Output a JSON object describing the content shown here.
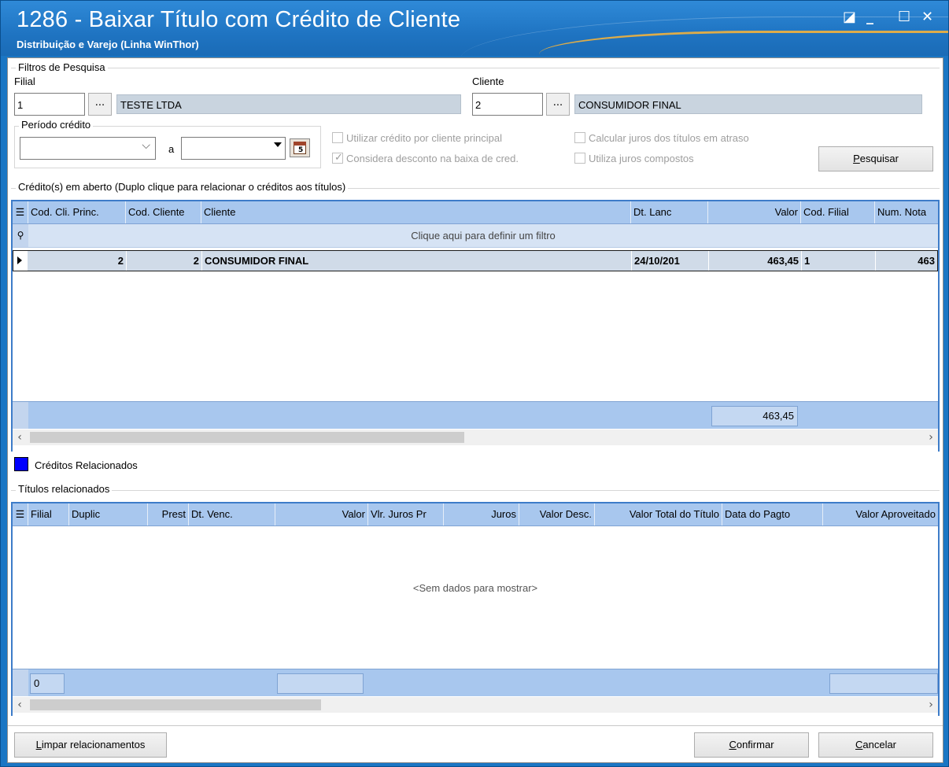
{
  "window": {
    "title": "1286 - Baixar Título com Crédito de Cliente",
    "subtitle": "Distribuição e Varejo (Linha WinThor)",
    "controls": {
      "restore": "◪",
      "minimize": "_",
      "maximize": "☐",
      "close": "✕"
    }
  },
  "filtros": {
    "legend": "Filtros de Pesquisa",
    "filial_label": "Filial",
    "filial_code": "1",
    "filial_name": "TESTE  LTDA",
    "cliente_label": "Cliente",
    "cliente_code": "2",
    "cliente_name": "CONSUMIDOR FINAL",
    "lookup_button": "...",
    "periodo_legend": "Período crédito",
    "periodo_from": "",
    "periodo_sep": "a",
    "periodo_to": "",
    "check_cliente_principal": "Utilizar crédito por cliente principal",
    "check_desconto": "Considera desconto na baixa de cred.",
    "check_juros_atraso": "Calcular juros dos títulos em atraso",
    "check_juros_compostos": "Utiliza juros compostos",
    "pesquisar_prefix": "P",
    "pesquisar_rest": "esquisar"
  },
  "creditos": {
    "legend": "Crédito(s) em aberto  (Duplo clique para relacionar o créditos aos títulos)",
    "columns": [
      "Cod. Cli. Princ.",
      "Cod. Cliente",
      "Cliente",
      "Dt. Lanc",
      "Valor",
      "Cod. Filial",
      "Num. Nota"
    ],
    "filter_hint": "Clique aqui para definir um filtro",
    "rows": [
      [
        "2",
        "2",
        "CONSUMIDOR FINAL",
        "24/10/201",
        "463,45",
        "1",
        "463"
      ]
    ],
    "total_valor": "463,45"
  },
  "legenda": {
    "relacionados": "Créditos Relacionados",
    "color": "#0000ff"
  },
  "titulos": {
    "legend": "Títulos relacionados",
    "columns": [
      "Filial",
      "Duplic",
      "Prest",
      "Dt. Venc.",
      "Valor",
      "Vlr. Juros Pr",
      "Juros",
      "Valor Desc.",
      "Valor Total do Título",
      "Data do Pagto",
      "Valor Aproveitado"
    ],
    "empty": "<Sem dados para mostrar>",
    "footer_count": "0"
  },
  "buttons": {
    "limpar_prefix": "L",
    "limpar_rest": "impar relacionamentos",
    "confirmar_prefix": "C",
    "confirmar_rest": "onfirmar",
    "cancelar_prefix": "C",
    "cancelar_rest": "ancelar"
  }
}
